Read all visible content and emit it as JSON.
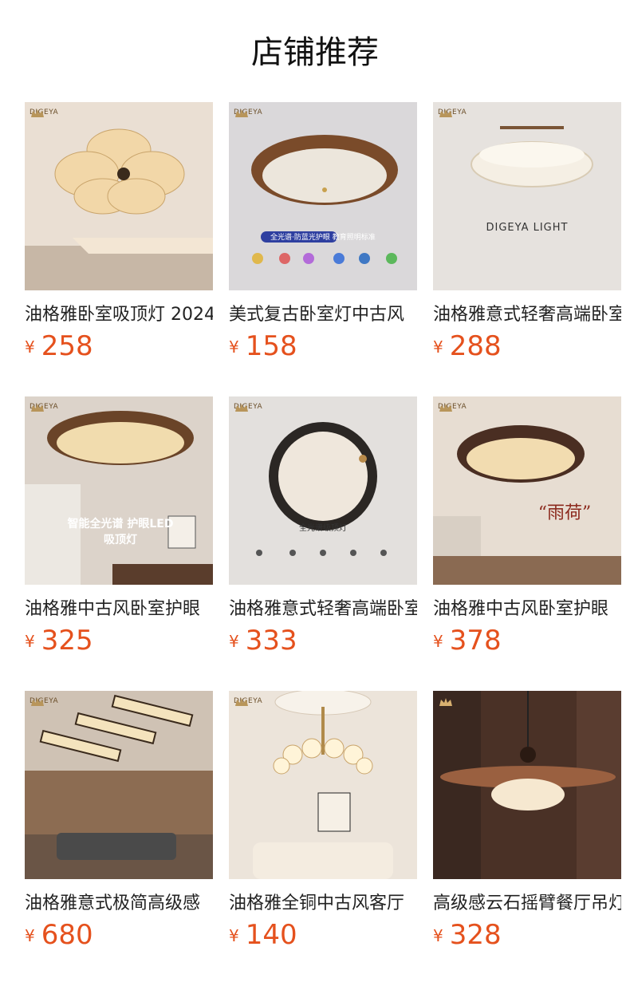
{
  "header": {
    "title": "店铺推荐"
  },
  "brand": {
    "logo_text": "DIGEYA"
  },
  "currency_symbol": "¥",
  "colors": {
    "price": "#e5511d",
    "title": "#111111"
  },
  "products": [
    {
      "name": "油格雅卧室吸顶灯 2024",
      "price": "258",
      "thumb_text": ""
    },
    {
      "name": "美式复古卧室灯中古风",
      "price": "158",
      "thumb_text": "全光谱·防蓝光护眼 教育照明标准"
    },
    {
      "name": "油格雅意式轻奢高端卧室",
      "price": "288",
      "thumb_text": "DIGEYA LIGHT"
    },
    {
      "name": "油格雅中古风卧室护眼",
      "price": "325",
      "thumb_text": "智能全光谱 护眼LED吸顶灯"
    },
    {
      "name": "油格雅意式轻奢高端卧室",
      "price": "333",
      "thumb_text": "全光谱级顶灯"
    },
    {
      "name": "油格雅中古风卧室护眼",
      "price": "378",
      "thumb_text": "“雨荷”"
    },
    {
      "name": "油格雅意式极简高级感",
      "price": "680",
      "thumb_text": ""
    },
    {
      "name": "油格雅全铜中古风客厅",
      "price": "140",
      "thumb_text": ""
    },
    {
      "name": "高级感云石摇臂餐厅吊灯",
      "price": "328",
      "thumb_text": ""
    }
  ]
}
